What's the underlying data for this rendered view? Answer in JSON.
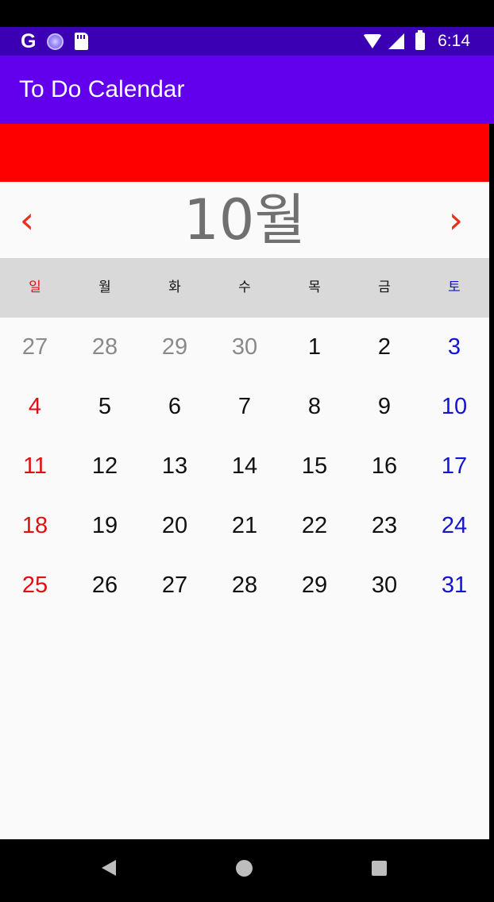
{
  "status_bar": {
    "left_icons": [
      "google-icon",
      "circle-icon",
      "sd-card-icon"
    ],
    "google_glyph": "G",
    "right_icons": [
      "wifi-icon",
      "signal-icon",
      "battery-icon"
    ],
    "time": "6:14"
  },
  "app_bar": {
    "title": "To Do Calendar"
  },
  "calendar": {
    "month_label": "10월",
    "prev_icon": "‹",
    "next_icon": "›",
    "weekdays": [
      "일",
      "월",
      "화",
      "수",
      "목",
      "금",
      "토"
    ],
    "days": [
      {
        "label": "27",
        "current": false
      },
      {
        "label": "28",
        "current": false
      },
      {
        "label": "29",
        "current": false
      },
      {
        "label": "30",
        "current": false
      },
      {
        "label": "1",
        "current": true
      },
      {
        "label": "2",
        "current": true
      },
      {
        "label": "3",
        "current": true
      },
      {
        "label": "4",
        "current": true
      },
      {
        "label": "5",
        "current": true
      },
      {
        "label": "6",
        "current": true
      },
      {
        "label": "7",
        "current": true
      },
      {
        "label": "8",
        "current": true
      },
      {
        "label": "9",
        "current": true
      },
      {
        "label": "10",
        "current": true
      },
      {
        "label": "11",
        "current": true
      },
      {
        "label": "12",
        "current": true
      },
      {
        "label": "13",
        "current": true
      },
      {
        "label": "14",
        "current": true
      },
      {
        "label": "15",
        "current": true
      },
      {
        "label": "16",
        "current": true
      },
      {
        "label": "17",
        "current": true
      },
      {
        "label": "18",
        "current": true
      },
      {
        "label": "19",
        "current": true
      },
      {
        "label": "20",
        "current": true
      },
      {
        "label": "21",
        "current": true
      },
      {
        "label": "22",
        "current": true
      },
      {
        "label": "23",
        "current": true
      },
      {
        "label": "24",
        "current": true
      },
      {
        "label": "25",
        "current": true
      },
      {
        "label": "26",
        "current": true
      },
      {
        "label": "27",
        "current": true
      },
      {
        "label": "28",
        "current": true
      },
      {
        "label": "29",
        "current": true
      },
      {
        "label": "30",
        "current": true
      },
      {
        "label": "31",
        "current": true
      }
    ]
  },
  "colors": {
    "status_bar": "#3c00b4",
    "app_bar": "#6200ee",
    "banner": "#ff0000",
    "nav_arrows": "#e5321e",
    "sunday": "#e01010",
    "saturday": "#1414d2",
    "other_month": "#8a8a8a",
    "weekday_header_bg": "#d9d9d9"
  },
  "system_nav": {
    "icons": [
      "back-icon",
      "home-icon",
      "recents-icon"
    ]
  }
}
